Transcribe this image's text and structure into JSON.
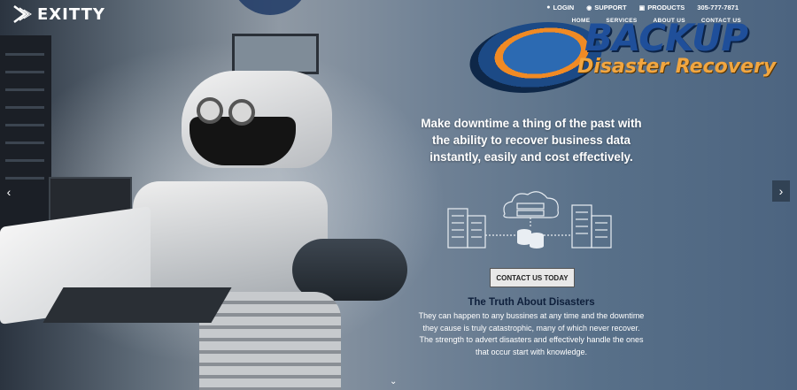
{
  "brand": {
    "name": "EXITTY"
  },
  "utility_nav": {
    "login": "LOGIN",
    "support": "SUPPORT",
    "products": "PRODUCTS",
    "phone": "305-777-7871"
  },
  "main_nav": [
    "HOME",
    "SERVICES",
    "ABOUT US",
    "CONTACT US"
  ],
  "hero_logo": {
    "line1": "BACKUP",
    "line2": "Disaster Recovery"
  },
  "hero": {
    "headline": "Make downtime a thing of the past with the ability to recover business data instantly, easily and cost effectively.",
    "cta_label": "CONTACT US TODAY",
    "section_title": "The Truth About Disasters",
    "section_body": "They can happen to any bussines at any time and the downtime they cause is truly catastrophic, many of which never recover. The strength to advert disasters and effectively handle the ones that occur start with knowledge."
  },
  "icons": {
    "login": "user-icon",
    "support": "globe-icon",
    "products": "box-icon",
    "prev": "chevron-left-icon",
    "next": "chevron-right-icon",
    "scroll": "chevron-down-icon"
  },
  "colors": {
    "title_dark": "#0e1f3b",
    "backup_blue": "#1f4f9a",
    "backup_orange": "#f1a640"
  }
}
